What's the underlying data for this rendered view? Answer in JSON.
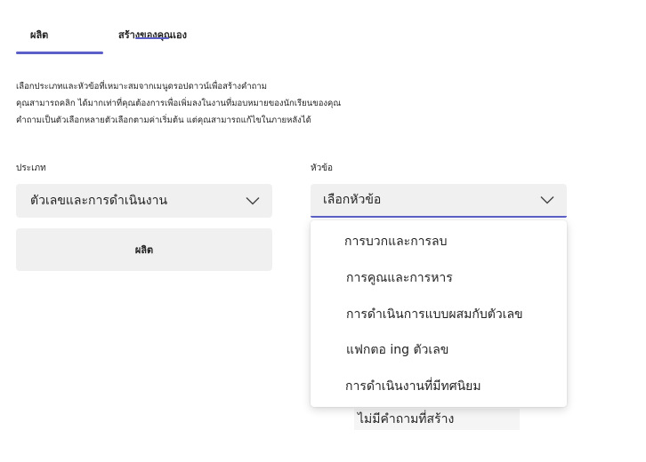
{
  "tabs": [
    {
      "label": "ผลิต",
      "selected": true
    },
    {
      "label": "สร้างของคุณเอง",
      "selected": false
    }
  ],
  "accent_color": "#5b5fc7",
  "description": [
    "เลือกประเภทและหัวข้อที่เหมาะสมจากเมนูดรอปดาวน์เพื่อสร้างคำถาม",
    "คุณสามารถคลิก ได้มากเท่าที่คุณต้องการเพื่อเพิ่มลงในงานที่มอบหมายของนักเรียนของคุณ",
    "คำถามเป็นตัวเลือกหลายตัวเลือกตามค่าเริ่มต้น แต่คุณสามารถแก้ไขในภายหลังได้"
  ],
  "type_field": {
    "label": "ประเภท",
    "value": "ตัวเลขและการดำเนินงาน",
    "icon": "chevron-down-icon"
  },
  "topic_field": {
    "label": "หัวข้อ",
    "value": "เลือกหัวข้อ",
    "icon": "chevron-down-icon",
    "options": [
      "การบวกและการลบ",
      "การคูณและการหาร",
      "การดำเนินการแบบผสมกับตัวเลข",
      "แฟกตอ ing ตัวเลข",
      "การดำเนินงานที่มีทศนิยม"
    ]
  },
  "generate_button": {
    "label": "ผลิต"
  },
  "empty_state": "ไม่มีคำถามที่สร้าง"
}
